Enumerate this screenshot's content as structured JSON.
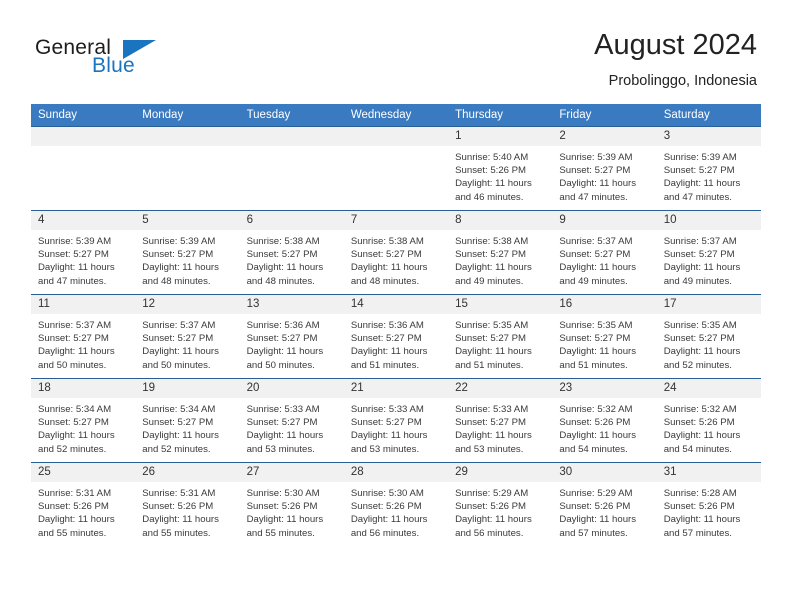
{
  "logo": {
    "word_one": "General",
    "word_two": "Blue",
    "icon": "triangle-icon",
    "accent_color": "#1a74c0"
  },
  "header": {
    "title": "August 2024",
    "subtitle": "Probolinggo, Indonesia"
  },
  "theme": {
    "header_row_background": "#3a7ac0",
    "header_row_text": "#ffffff",
    "row_separator": "#2a5f96",
    "daynum_background": "#f1f1f1",
    "body_text": "#3a3a3a"
  },
  "calendar": {
    "weekday_headers": [
      "Sunday",
      "Monday",
      "Tuesday",
      "Wednesday",
      "Thursday",
      "Friday",
      "Saturday"
    ],
    "weeks": [
      [
        {
          "day": "",
          "sunrise": "",
          "sunset": "",
          "daylight_line1": "",
          "daylight_line2": "",
          "blank": true
        },
        {
          "day": "",
          "sunrise": "",
          "sunset": "",
          "daylight_line1": "",
          "daylight_line2": "",
          "blank": true
        },
        {
          "day": "",
          "sunrise": "",
          "sunset": "",
          "daylight_line1": "",
          "daylight_line2": "",
          "blank": true
        },
        {
          "day": "",
          "sunrise": "",
          "sunset": "",
          "daylight_line1": "",
          "daylight_line2": "",
          "blank": true
        },
        {
          "day": "1",
          "sunrise": "Sunrise: 5:40 AM",
          "sunset": "Sunset: 5:26 PM",
          "daylight_line1": "Daylight: 11 hours",
          "daylight_line2": "and 46 minutes.",
          "blank": false
        },
        {
          "day": "2",
          "sunrise": "Sunrise: 5:39 AM",
          "sunset": "Sunset: 5:27 PM",
          "daylight_line1": "Daylight: 11 hours",
          "daylight_line2": "and 47 minutes.",
          "blank": false
        },
        {
          "day": "3",
          "sunrise": "Sunrise: 5:39 AM",
          "sunset": "Sunset: 5:27 PM",
          "daylight_line1": "Daylight: 11 hours",
          "daylight_line2": "and 47 minutes.",
          "blank": false
        }
      ],
      [
        {
          "day": "4",
          "sunrise": "Sunrise: 5:39 AM",
          "sunset": "Sunset: 5:27 PM",
          "daylight_line1": "Daylight: 11 hours",
          "daylight_line2": "and 47 minutes.",
          "blank": false
        },
        {
          "day": "5",
          "sunrise": "Sunrise: 5:39 AM",
          "sunset": "Sunset: 5:27 PM",
          "daylight_line1": "Daylight: 11 hours",
          "daylight_line2": "and 48 minutes.",
          "blank": false
        },
        {
          "day": "6",
          "sunrise": "Sunrise: 5:38 AM",
          "sunset": "Sunset: 5:27 PM",
          "daylight_line1": "Daylight: 11 hours",
          "daylight_line2": "and 48 minutes.",
          "blank": false
        },
        {
          "day": "7",
          "sunrise": "Sunrise: 5:38 AM",
          "sunset": "Sunset: 5:27 PM",
          "daylight_line1": "Daylight: 11 hours",
          "daylight_line2": "and 48 minutes.",
          "blank": false
        },
        {
          "day": "8",
          "sunrise": "Sunrise: 5:38 AM",
          "sunset": "Sunset: 5:27 PM",
          "daylight_line1": "Daylight: 11 hours",
          "daylight_line2": "and 49 minutes.",
          "blank": false
        },
        {
          "day": "9",
          "sunrise": "Sunrise: 5:37 AM",
          "sunset": "Sunset: 5:27 PM",
          "daylight_line1": "Daylight: 11 hours",
          "daylight_line2": "and 49 minutes.",
          "blank": false
        },
        {
          "day": "10",
          "sunrise": "Sunrise: 5:37 AM",
          "sunset": "Sunset: 5:27 PM",
          "daylight_line1": "Daylight: 11 hours",
          "daylight_line2": "and 49 minutes.",
          "blank": false
        }
      ],
      [
        {
          "day": "11",
          "sunrise": "Sunrise: 5:37 AM",
          "sunset": "Sunset: 5:27 PM",
          "daylight_line1": "Daylight: 11 hours",
          "daylight_line2": "and 50 minutes.",
          "blank": false
        },
        {
          "day": "12",
          "sunrise": "Sunrise: 5:37 AM",
          "sunset": "Sunset: 5:27 PM",
          "daylight_line1": "Daylight: 11 hours",
          "daylight_line2": "and 50 minutes.",
          "blank": false
        },
        {
          "day": "13",
          "sunrise": "Sunrise: 5:36 AM",
          "sunset": "Sunset: 5:27 PM",
          "daylight_line1": "Daylight: 11 hours",
          "daylight_line2": "and 50 minutes.",
          "blank": false
        },
        {
          "day": "14",
          "sunrise": "Sunrise: 5:36 AM",
          "sunset": "Sunset: 5:27 PM",
          "daylight_line1": "Daylight: 11 hours",
          "daylight_line2": "and 51 minutes.",
          "blank": false
        },
        {
          "day": "15",
          "sunrise": "Sunrise: 5:35 AM",
          "sunset": "Sunset: 5:27 PM",
          "daylight_line1": "Daylight: 11 hours",
          "daylight_line2": "and 51 minutes.",
          "blank": false
        },
        {
          "day": "16",
          "sunrise": "Sunrise: 5:35 AM",
          "sunset": "Sunset: 5:27 PM",
          "daylight_line1": "Daylight: 11 hours",
          "daylight_line2": "and 51 minutes.",
          "blank": false
        },
        {
          "day": "17",
          "sunrise": "Sunrise: 5:35 AM",
          "sunset": "Sunset: 5:27 PM",
          "daylight_line1": "Daylight: 11 hours",
          "daylight_line2": "and 52 minutes.",
          "blank": false
        }
      ],
      [
        {
          "day": "18",
          "sunrise": "Sunrise: 5:34 AM",
          "sunset": "Sunset: 5:27 PM",
          "daylight_line1": "Daylight: 11 hours",
          "daylight_line2": "and 52 minutes.",
          "blank": false
        },
        {
          "day": "19",
          "sunrise": "Sunrise: 5:34 AM",
          "sunset": "Sunset: 5:27 PM",
          "daylight_line1": "Daylight: 11 hours",
          "daylight_line2": "and 52 minutes.",
          "blank": false
        },
        {
          "day": "20",
          "sunrise": "Sunrise: 5:33 AM",
          "sunset": "Sunset: 5:27 PM",
          "daylight_line1": "Daylight: 11 hours",
          "daylight_line2": "and 53 minutes.",
          "blank": false
        },
        {
          "day": "21",
          "sunrise": "Sunrise: 5:33 AM",
          "sunset": "Sunset: 5:27 PM",
          "daylight_line1": "Daylight: 11 hours",
          "daylight_line2": "and 53 minutes.",
          "blank": false
        },
        {
          "day": "22",
          "sunrise": "Sunrise: 5:33 AM",
          "sunset": "Sunset: 5:27 PM",
          "daylight_line1": "Daylight: 11 hours",
          "daylight_line2": "and 53 minutes.",
          "blank": false
        },
        {
          "day": "23",
          "sunrise": "Sunrise: 5:32 AM",
          "sunset": "Sunset: 5:26 PM",
          "daylight_line1": "Daylight: 11 hours",
          "daylight_line2": "and 54 minutes.",
          "blank": false
        },
        {
          "day": "24",
          "sunrise": "Sunrise: 5:32 AM",
          "sunset": "Sunset: 5:26 PM",
          "daylight_line1": "Daylight: 11 hours",
          "daylight_line2": "and 54 minutes.",
          "blank": false
        }
      ],
      [
        {
          "day": "25",
          "sunrise": "Sunrise: 5:31 AM",
          "sunset": "Sunset: 5:26 PM",
          "daylight_line1": "Daylight: 11 hours",
          "daylight_line2": "and 55 minutes.",
          "blank": false
        },
        {
          "day": "26",
          "sunrise": "Sunrise: 5:31 AM",
          "sunset": "Sunset: 5:26 PM",
          "daylight_line1": "Daylight: 11 hours",
          "daylight_line2": "and 55 minutes.",
          "blank": false
        },
        {
          "day": "27",
          "sunrise": "Sunrise: 5:30 AM",
          "sunset": "Sunset: 5:26 PM",
          "daylight_line1": "Daylight: 11 hours",
          "daylight_line2": "and 55 minutes.",
          "blank": false
        },
        {
          "day": "28",
          "sunrise": "Sunrise: 5:30 AM",
          "sunset": "Sunset: 5:26 PM",
          "daylight_line1": "Daylight: 11 hours",
          "daylight_line2": "and 56 minutes.",
          "blank": false
        },
        {
          "day": "29",
          "sunrise": "Sunrise: 5:29 AM",
          "sunset": "Sunset: 5:26 PM",
          "daylight_line1": "Daylight: 11 hours",
          "daylight_line2": "and 56 minutes.",
          "blank": false
        },
        {
          "day": "30",
          "sunrise": "Sunrise: 5:29 AM",
          "sunset": "Sunset: 5:26 PM",
          "daylight_line1": "Daylight: 11 hours",
          "daylight_line2": "and 57 minutes.",
          "blank": false
        },
        {
          "day": "31",
          "sunrise": "Sunrise: 5:28 AM",
          "sunset": "Sunset: 5:26 PM",
          "daylight_line1": "Daylight: 11 hours",
          "daylight_line2": "and 57 minutes.",
          "blank": false
        }
      ]
    ]
  }
}
